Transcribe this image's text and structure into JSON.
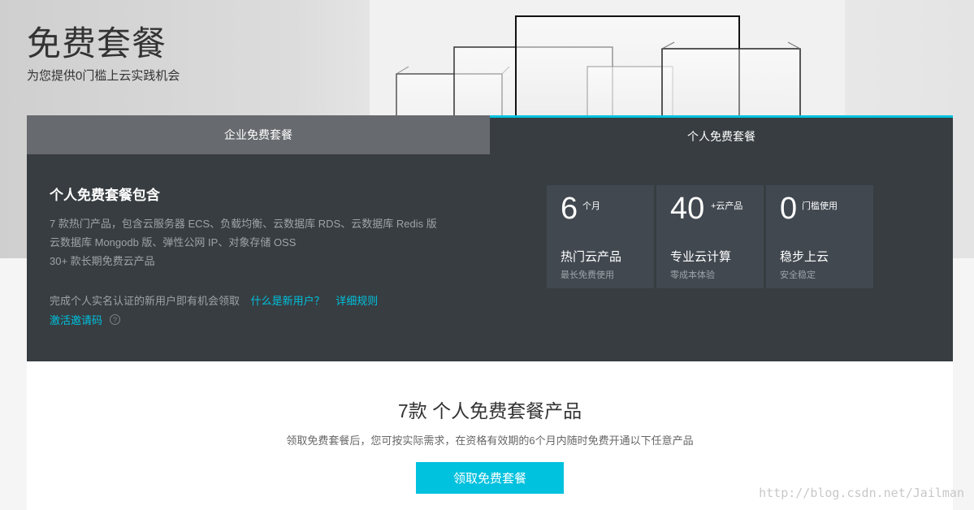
{
  "hero": {
    "title": "免费套餐",
    "subtitle": "为您提供0门槛上云实践机会"
  },
  "tabs": [
    {
      "label": "企业免费套餐",
      "active": false
    },
    {
      "label": "个人免费套餐",
      "active": true
    }
  ],
  "panel": {
    "title": "个人免费套餐包含",
    "lines": [
      "7  款热门产品，包含云服务器 ECS、负载均衡、云数据库 RDS、云数据库 Redis 版",
      "云数据库 Mongodb 版、弹性公网 IP、对象存储 OSS",
      "30+ 款长期免费云产品"
    ],
    "note": "完成个人实名认证的新用户即有机会领取",
    "link_new_user": "什么是新用户？",
    "link_rules": "详细规则",
    "invite_link": "激活邀请码",
    "help_icon": "question-circle-icon"
  },
  "stats": [
    {
      "number": "6",
      "unit": "个月",
      "name": "热门云产品",
      "desc": "最长免费使用"
    },
    {
      "number": "40",
      "unit": "+云产品",
      "name": "专业云计算",
      "desc": "零成本体验"
    },
    {
      "number": "0",
      "unit": "门槛使用",
      "name": "稳步上云",
      "desc": "安全稳定"
    }
  ],
  "products": {
    "title": "7款 个人免费套餐产品",
    "desc": "领取免费套餐后，您可按实际需求，在资格有效期的6个月内随时免费开通以下任意产品",
    "button": "领取免费套餐"
  },
  "watermark": "http://blog.csdn.net/Jailman",
  "colors": {
    "accent": "#00c1de",
    "panel_bg": "#373d41",
    "tab_inactive": "#676a6e",
    "stat_bg": "#414850"
  }
}
